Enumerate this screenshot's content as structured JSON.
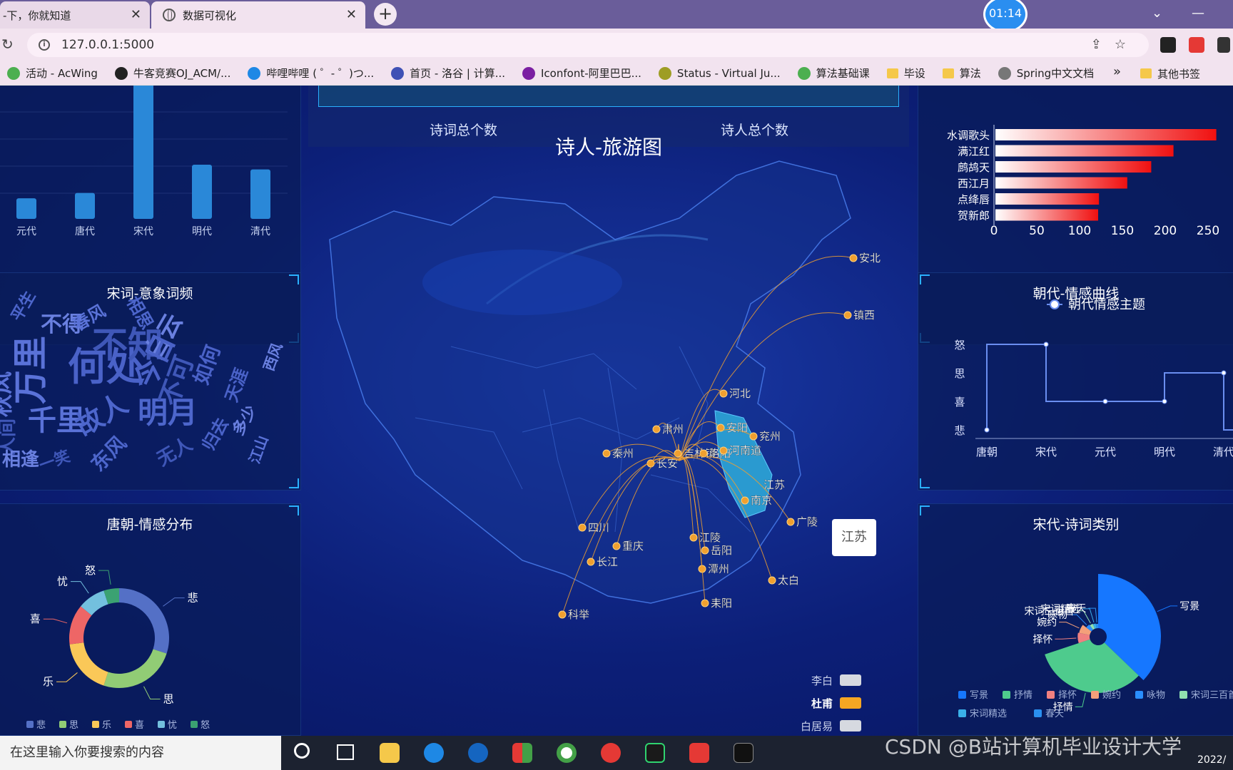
{
  "browser": {
    "tabs": [
      {
        "title": "-下，你就知道",
        "close": "✕"
      },
      {
        "title": "数据可视化",
        "close": "✕"
      }
    ],
    "new_tab": "+",
    "timer": "01:14",
    "url": "127.0.0.1:5000",
    "bookmarks": [
      {
        "label": "活动 - AcWing",
        "color": "#4caf50"
      },
      {
        "label": "牛客竞赛OJ_ACM/...",
        "color": "#222"
      },
      {
        "label": "哔哩哔哩 ( ゜- ゜)つ...",
        "color": "#1e88e5"
      },
      {
        "label": "首页 - 洛谷 | 计算...",
        "color": "#3f51b5"
      },
      {
        "label": "Iconfont-阿里巴巴...",
        "color": "#7b1fa2"
      },
      {
        "label": "Status - Virtual Ju...",
        "color": "#9e9d24"
      },
      {
        "label": "算法基础课",
        "color": "#4caf50"
      },
      {
        "label": "毕设",
        "folder": true
      },
      {
        "label": "算法",
        "folder": true
      },
      {
        "label": "Spring中文文档",
        "color": "#777"
      }
    ],
    "bookmarks_more": "»",
    "other_bookmarks": "其他书签"
  },
  "dashboard": {
    "stats": {
      "poems_label": "诗词总个数",
      "poets_label": "诗人总个数"
    },
    "map": {
      "title": "诗人-旅游图",
      "highlighted_region": "江苏",
      "tooltip": "江苏",
      "places": [
        "安北",
        "镇西",
        "河北",
        "肃州",
        "安阳",
        "兖州",
        "秦州",
        "吉林镇",
        "洛阳",
        "河南道",
        "长安",
        "江苏",
        "南京",
        "广陵",
        "四川",
        "重庆",
        "江陵",
        "岳阳",
        "长江",
        "潭州",
        "太白",
        "科举",
        "耒阳"
      ],
      "legend": [
        {
          "name": "李白",
          "color": "#d6d9e0",
          "active": false
        },
        {
          "name": "杜甫",
          "color": "#f5a623",
          "active": true
        },
        {
          "name": "白居易",
          "color": "#d6d9e0",
          "active": false
        }
      ],
      "route_color": "#f0a030"
    },
    "dynasty_bar": {
      "chart_data": {
        "type": "bar",
        "categories": [
          "元代",
          "唐代",
          "宋代",
          "明代",
          "清代"
        ],
        "values": [
          35,
          44,
          230,
          92,
          84
        ],
        "ylim": [
          0,
          230
        ]
      }
    },
    "word_cloud": {
      "title": "宋词-意象词频",
      "words": [
        "何处",
        "万里",
        "不知",
        "白云",
        "明月",
        "今日",
        "千里",
        "不可",
        "不得",
        "故人",
        "如何",
        "秋风",
        "人间",
        "相逢",
        "东风",
        "天涯",
        "春风",
        "无人",
        "多少",
        "相思",
        "归去",
        "江山",
        "一笑",
        "西风",
        "平生"
      ]
    },
    "tang_emotion": {
      "title": "唐朝-情感分布",
      "chart_data": {
        "type": "pie",
        "categories": [
          "悲",
          "思",
          "乐",
          "喜",
          "忧",
          "怒"
        ],
        "values": [
          30,
          25,
          18,
          13,
          9,
          5
        ],
        "colors": [
          "#5470c6",
          "#91cc75",
          "#fac858",
          "#ee6666",
          "#73c0de",
          "#3ba272"
        ]
      }
    },
    "top_poems": {
      "chart_data": {
        "type": "bar",
        "orientation": "horizontal",
        "categories": [
          "水调歌头",
          "满江红",
          "鹧鸪天",
          "西江月",
          "点绛唇",
          "贺新郎"
        ],
        "values": [
          258,
          208,
          182,
          154,
          121,
          120
        ],
        "xticks": [
          0,
          50,
          100,
          150,
          200,
          250
        ],
        "xlim": [
          0,
          260
        ]
      }
    },
    "emotion_curve": {
      "title": "朝代-情感曲线",
      "chart_data": {
        "type": "line",
        "step": true,
        "series": [
          {
            "name": "朝代情感主题",
            "values": [
              "悲",
              "怒",
              "喜",
              "喜",
              "思",
              "悲"
            ]
          }
        ],
        "x": [
          "唐朝",
          "宋代",
          "元代",
          "明代",
          "清代",
          ""
        ],
        "y_categories": [
          "悲",
          "喜",
          "思",
          "怒"
        ],
        "x_tick_labels": [
          "唐朝",
          "宋代",
          "元代",
          "明代",
          "清代"
        ]
      }
    },
    "song_category": {
      "title": "宋代-诗词类别",
      "chart_data": {
        "type": "pie",
        "rose": true,
        "categories": [
          "写景",
          "抒情",
          "择怀",
          "婉约",
          "咏物",
          "宋词三百首",
          "宋词精选",
          "春天"
        ],
        "values": [
          100,
          88,
          22,
          20,
          12,
          10,
          9,
          8
        ],
        "colors": [
          "#1677ff",
          "#4ecb8d",
          "#f08080",
          "#f4a07a",
          "#2a8fff",
          "#90e0b0",
          "#3ab0e8",
          "#2a90f0"
        ],
        "legend_labels": [
          "写景",
          "抒情",
          "择怀",
          "婉约",
          "咏物",
          "宋词三百首",
          "宋词精选",
          "春天"
        ]
      }
    }
  },
  "taskbar": {
    "search_placeholder": "在这里输入你要搜索的内容",
    "watermark": "CSDN @B站计算机毕业设计大学",
    "date": "2022/"
  }
}
